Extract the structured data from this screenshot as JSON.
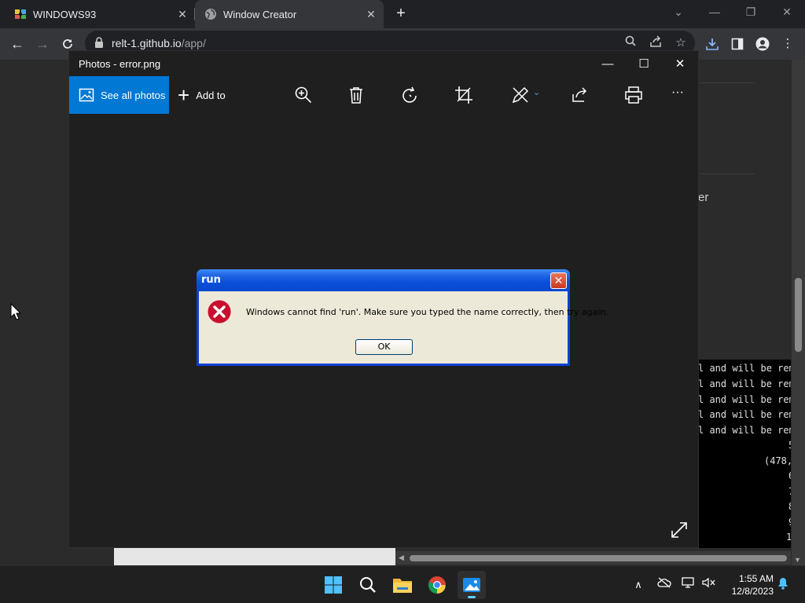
{
  "browser": {
    "tabs": [
      {
        "title": "WINDOWS93",
        "active": false
      },
      {
        "title": "Window Creator",
        "active": true
      }
    ],
    "new_tab_label": "+",
    "url_host": "relt-1.github.io",
    "url_path": "/app/"
  },
  "page": {
    "text_fragment": "er",
    "console_lines": [
      "l and will be remo",
      "l and will be remo",
      "l and will be remo",
      "l and will be remo",
      "l and will be remo",
      "5",
      "(478,",
      "6",
      "7",
      "8",
      "9",
      "1"
    ]
  },
  "photos": {
    "title": "Photos - error.png",
    "see_all_label": "See all photos",
    "add_to_label": "Add to",
    "more_label": "···"
  },
  "dialog": {
    "title": "run",
    "message": "Windows cannot find 'run'. Make sure you typed the name correctly, then try again.",
    "ok_label": "OK"
  },
  "taskbar": {
    "time": "1:55 AM",
    "date": "12/8/2023",
    "accent": "#60cdff"
  },
  "colors": {
    "photos_accent": "#0078d4",
    "xp_title_blue": "#0a4fd8",
    "xp_dialog_face": "#ece9d8"
  }
}
